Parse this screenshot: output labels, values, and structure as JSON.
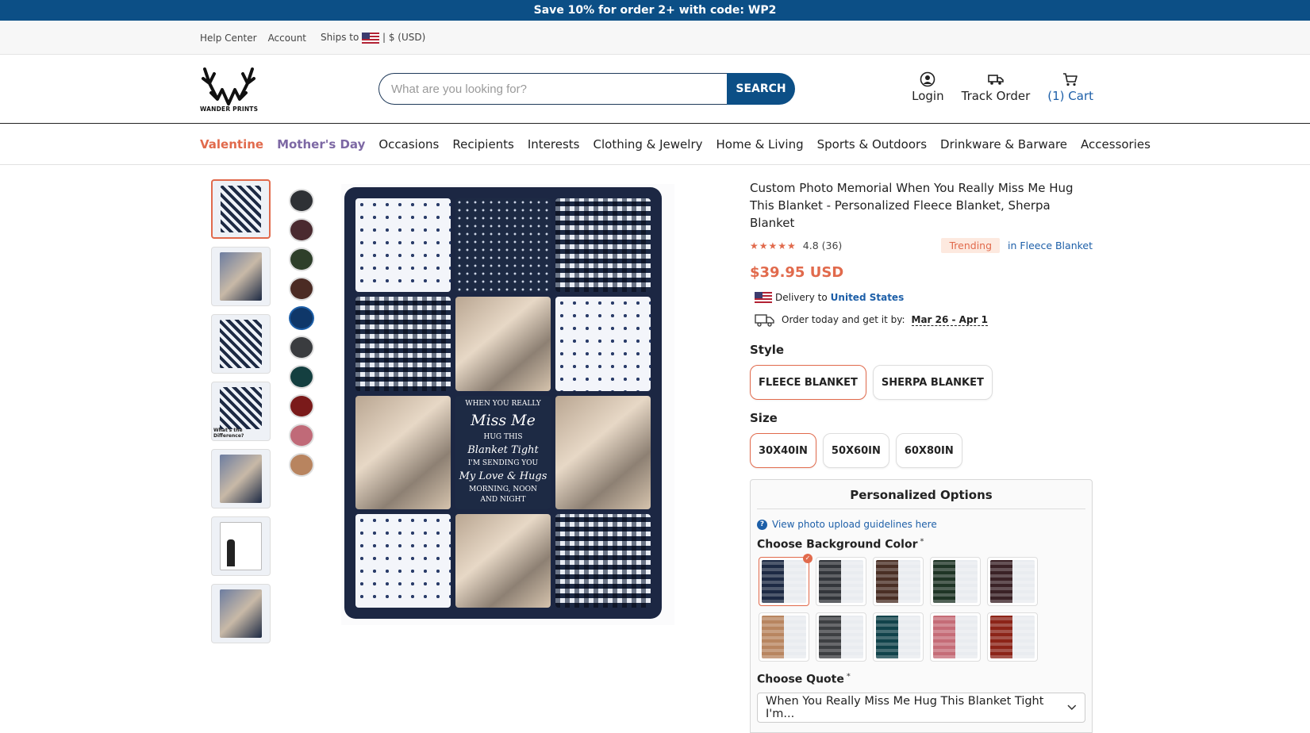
{
  "promo": {
    "text": "Save 10% for order 2+ with code: ",
    "code": "WP2"
  },
  "utility": {
    "help": "Help Center",
    "account": "Account",
    "ships_to": "Ships to",
    "currency": "| $ (USD)"
  },
  "brand": {
    "logo_text": "WANDER PRINTS"
  },
  "search": {
    "placeholder": "What are you looking for?",
    "button": "SEARCH"
  },
  "header_actions": {
    "login": "Login",
    "track": "Track Order",
    "cart": "(1) Cart"
  },
  "nav": [
    "Valentine",
    "Mother's Day",
    "Occasions",
    "Recipients",
    "Interests",
    "Clothing & Jewelry",
    "Home & Living",
    "Sports & Outdoors",
    "Drinkware & Barware",
    "Accessories"
  ],
  "thumbnail_caption": "What's the Difference?",
  "swatch_colors": [
    "#2e3135",
    "#4a2a30",
    "#2e3f2a",
    "#4b2b24",
    "#0f3769",
    "#3a3c3f",
    "#143f40",
    "#7a1a1a",
    "#c06a78",
    "#b8845f"
  ],
  "product": {
    "title": "Custom Photo Memorial When You Really Miss Me Hug This Blanket - Personalized Fleece Blanket, Sherpa Blanket",
    "stars": "★★★★★",
    "rating": "4.8 (36)",
    "trending": "Trending",
    "in_category": "in Fleece Blanket",
    "price": "$39.95 USD",
    "delivery_label": "Delivery to",
    "delivery_location": "United States",
    "order_label": "Order today and get it by:",
    "order_dates": "Mar 26 - Apr 1"
  },
  "blanket_quote": {
    "l1": "WHEN YOU REALLY",
    "l2": "Miss Me",
    "l3": "HUG THIS",
    "l4": "Blanket Tight",
    "l5": "I'M SENDING YOU",
    "l6": "My Love & Hugs",
    "l7": "MORNING, NOON",
    "l8": "AND NIGHT"
  },
  "style": {
    "label": "Style",
    "options": [
      "FLEECE BLANKET",
      "SHERPA BLANKET"
    ],
    "selected": "FLEECE BLANKET"
  },
  "size": {
    "label": "Size",
    "options": [
      "30X40IN",
      "50X60IN",
      "60X80IN"
    ],
    "selected": "30X40IN"
  },
  "personalized": {
    "title": "Personalized Options",
    "guide": "View photo upload guidelines here",
    "bg_label": "Choose Background Color",
    "bg_colors": [
      "#1d2a44",
      "#33363b",
      "#4a2f25",
      "#1f3526",
      "#3a2226",
      "#b88560",
      "#3d3f42",
      "#11434b",
      "#c56c77",
      "#8c2418"
    ],
    "bg_selected": 0,
    "quote_label": "Choose Quote",
    "quote_value": "When You Really Miss Me Hug This Blanket Tight I'm..."
  }
}
